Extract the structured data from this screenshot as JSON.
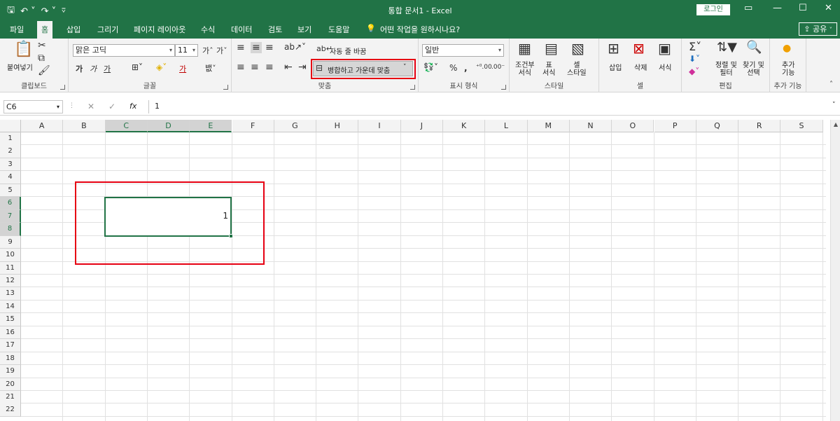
{
  "titlebar": {
    "title": "통합 문서1  -  Excel",
    "login": "로그인"
  },
  "tabs": [
    "파일",
    "홈",
    "삽입",
    "그리기",
    "페이지 레이아웃",
    "수식",
    "데이터",
    "검토",
    "보기",
    "도움말"
  ],
  "tell_me": "어떤 작업을 원하시나요?",
  "share": "공유",
  "ribbon": {
    "clipboard": {
      "paste": "붙여넣기",
      "label": "클립보드"
    },
    "font": {
      "name": "맑은 고딕",
      "size": "11",
      "bold": "가",
      "italic": "가",
      "underline": "가",
      "color_a": "가",
      "label": "글꼴"
    },
    "alignment": {
      "wrap_text": "자동 줄 바꿈",
      "merge_center": "병합하고 가운데 맞춤",
      "label": "맞춤"
    },
    "number": {
      "format": "일반",
      "percent": "%",
      "comma": ",",
      "label": "표시 형식"
    },
    "styles": {
      "conditional": "조건부\n서식",
      "table": "표\n서식",
      "cell_style": "셀\n스타일",
      "label": "스타일"
    },
    "cells": {
      "insert": "삽입",
      "delete": "삭제",
      "format": "서식",
      "label": "셀"
    },
    "editing": {
      "sort_filter": "정렬 및\n필터",
      "find_select": "찾기 및\n선택",
      "label": "편집"
    },
    "addins": {
      "addins": "추가\n기능",
      "label": "추가 기능"
    }
  },
  "formula_bar": {
    "name_box": "C6",
    "fx": "fx",
    "value": "1"
  },
  "columns": [
    "A",
    "B",
    "C",
    "D",
    "E",
    "F",
    "G",
    "H",
    "I",
    "J",
    "K",
    "L",
    "M",
    "N",
    "O",
    "P",
    "Q",
    "R",
    "S"
  ],
  "rows": [
    "1",
    "2",
    "3",
    "4",
    "5",
    "6",
    "7",
    "8",
    "9",
    "10",
    "11",
    "12",
    "13",
    "14",
    "15",
    "16",
    "17",
    "18",
    "19",
    "20",
    "21",
    "22"
  ],
  "merged_cell": {
    "range": "C6:E8",
    "value": "1"
  },
  "colors": {
    "excel_green": "#217346",
    "highlight_red": "#e60012"
  }
}
